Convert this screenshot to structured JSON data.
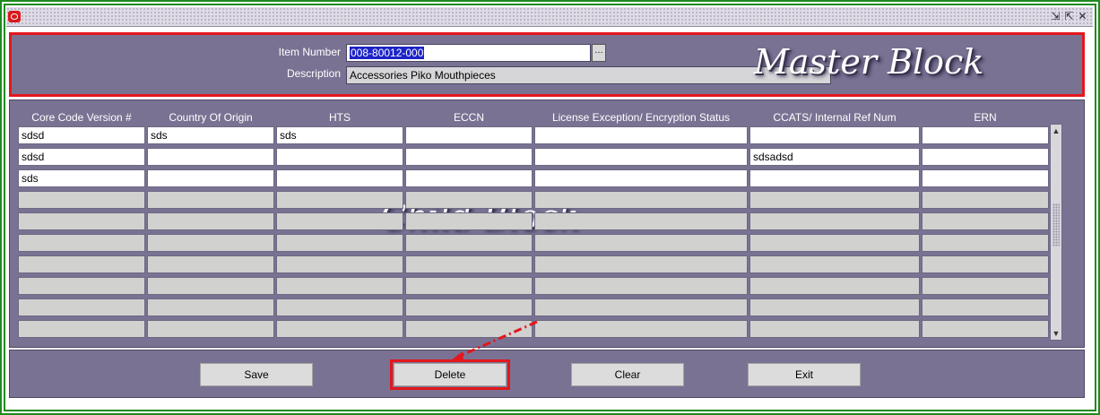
{
  "window": {
    "logo_icon": "oracle-logo-icon",
    "controls": [
      {
        "icon": "minimize-icon",
        "glyph": "⇲"
      },
      {
        "icon": "maximize-icon",
        "glyph": "⇱"
      },
      {
        "icon": "close-icon",
        "glyph": "✕"
      }
    ]
  },
  "master": {
    "item_number_label": "Item Number",
    "item_number_value": "008-80012-000",
    "description_label": "Description",
    "description_value": "Accessories Piko Mouthpieces",
    "lov_button_glyph": "…",
    "annotation": "Master Block"
  },
  "child": {
    "annotation": "Child Block",
    "columns": [
      "Core Code Version #",
      "Country Of Origin",
      "HTS",
      "ECCN",
      "License Exception/ Encryption Status",
      "CCATS/ Internal Ref Num",
      "ERN"
    ],
    "rows": [
      [
        "sdsd",
        "sds",
        "sds",
        "",
        "",
        "",
        ""
      ],
      [
        "sdsd",
        "",
        "",
        "",
        "",
        "sdsadsd",
        ""
      ],
      [
        "sds",
        "",
        "",
        "",
        "",
        "",
        ""
      ],
      [
        "",
        "",
        "",
        "",
        "",
        "",
        ""
      ],
      [
        "",
        "",
        "",
        "",
        "",
        "",
        ""
      ],
      [
        "",
        "",
        "",
        "",
        "",
        "",
        ""
      ],
      [
        "",
        "",
        "",
        "",
        "",
        "",
        ""
      ],
      [
        "",
        "",
        "",
        "",
        "",
        "",
        ""
      ],
      [
        "",
        "",
        "",
        "",
        "",
        "",
        ""
      ],
      [
        "",
        "",
        "",
        "",
        "",
        "",
        ""
      ]
    ],
    "scroll_up_glyph": "▲",
    "scroll_down_glyph": "▼"
  },
  "buttons": {
    "save": "Save",
    "delete": "Delete",
    "clear": "Clear",
    "exit": "Exit"
  },
  "colors": {
    "panel": "#7a7293",
    "highlight": "#e3171c",
    "frame": "#1f8a1f",
    "selection": "#1c23c8"
  }
}
